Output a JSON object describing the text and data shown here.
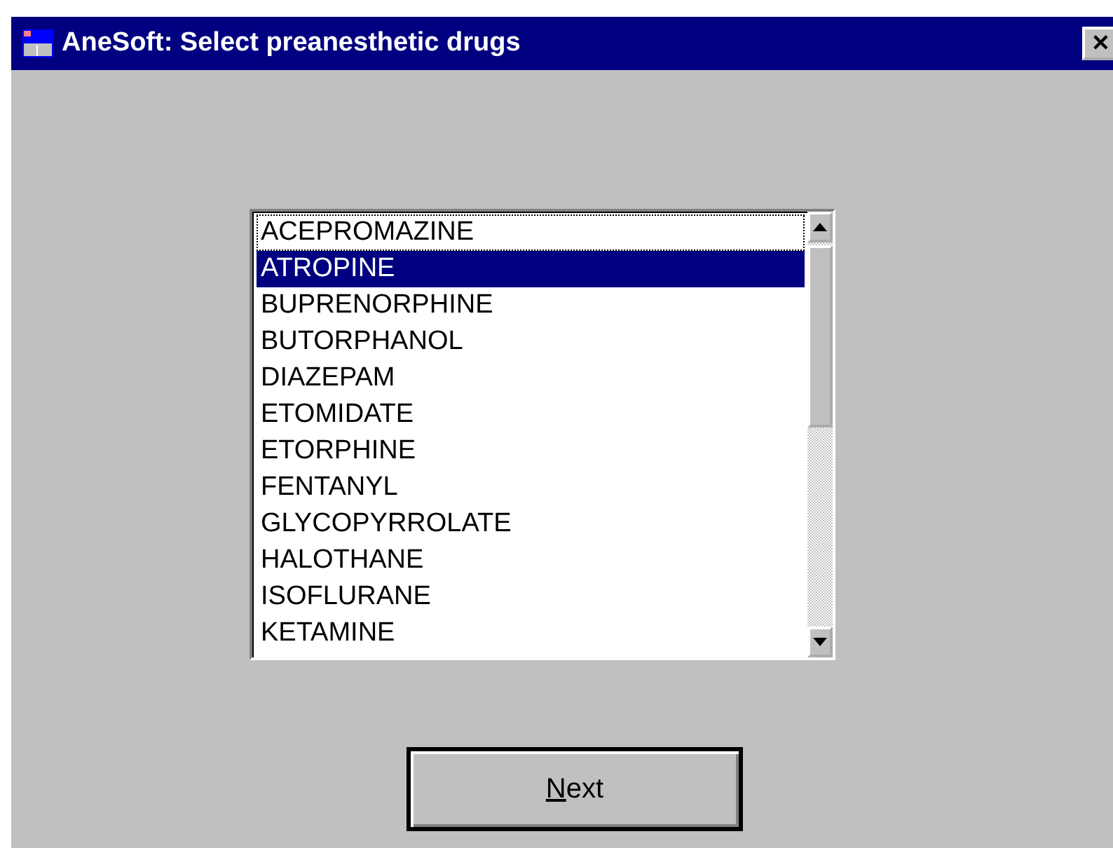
{
  "window": {
    "title": "AneSoft: Select preanesthetic drugs",
    "close_label": "✕"
  },
  "drug_list": {
    "items": [
      {
        "label": "ACEPROMAZINE",
        "selected": false,
        "focused": true
      },
      {
        "label": "ATROPINE",
        "selected": true,
        "focused": false
      },
      {
        "label": "BUPRENORPHINE",
        "selected": false,
        "focused": false
      },
      {
        "label": "BUTORPHANOL",
        "selected": false,
        "focused": false
      },
      {
        "label": "DIAZEPAM",
        "selected": false,
        "focused": false
      },
      {
        "label": "ETOMIDATE",
        "selected": false,
        "focused": false
      },
      {
        "label": "ETORPHINE",
        "selected": false,
        "focused": false
      },
      {
        "label": "FENTANYL",
        "selected": false,
        "focused": false
      },
      {
        "label": "GLYCOPYRROLATE",
        "selected": false,
        "focused": false
      },
      {
        "label": "HALOTHANE",
        "selected": false,
        "focused": false
      },
      {
        "label": "ISOFLURANE",
        "selected": false,
        "focused": false
      },
      {
        "label": "KETAMINE",
        "selected": false,
        "focused": false
      }
    ]
  },
  "buttons": [
    {
      "label": "Next",
      "default": true
    }
  ]
}
